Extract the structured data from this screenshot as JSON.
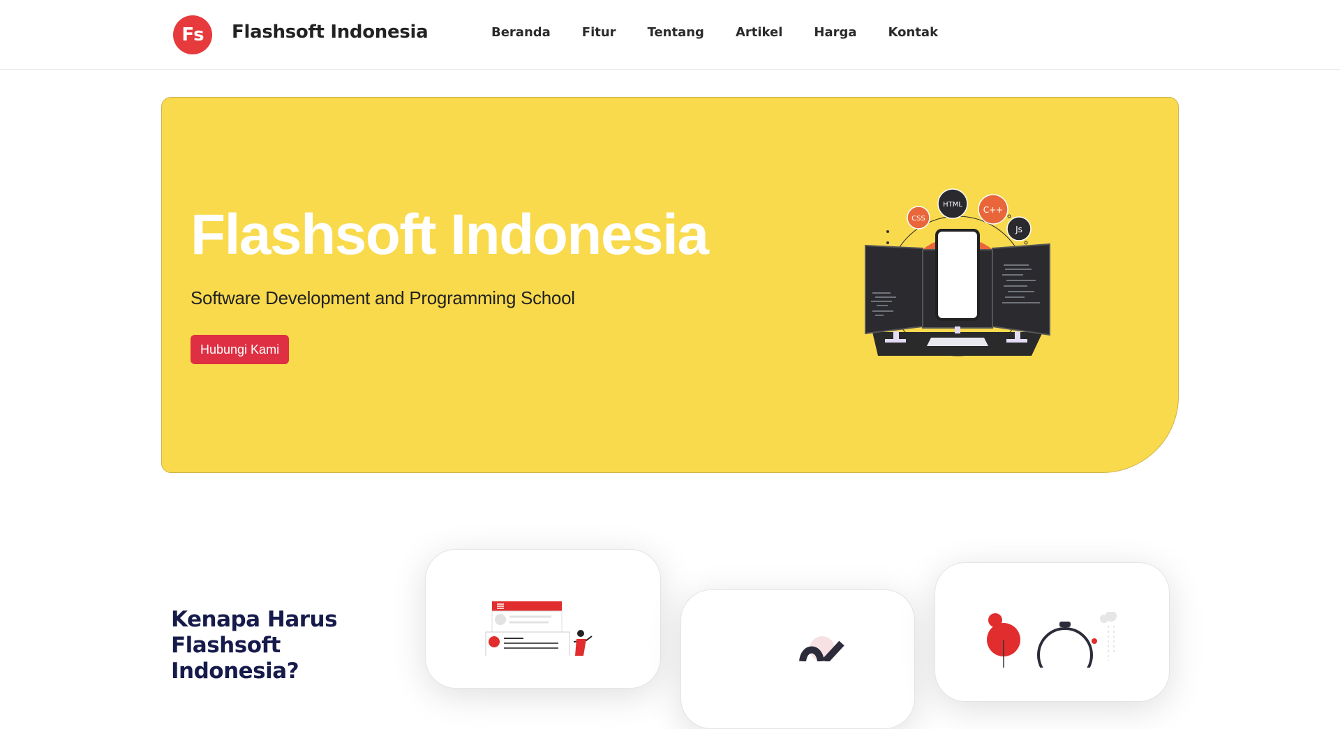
{
  "header": {
    "logo_text": "Fs",
    "brand": "Flashsoft Indonesia",
    "nav": [
      "Beranda",
      "Fitur",
      "Tentang",
      "Artikel",
      "Harga",
      "Kontak"
    ]
  },
  "hero": {
    "title": "Flashsoft Indonesia",
    "subtitle": "Software Development and Programming School",
    "cta_label": "Hubungi Kami",
    "illustration_labels": [
      "CSS",
      "HTML",
      "C++",
      "Js"
    ]
  },
  "why": {
    "title": "Kenapa Harus Flashsoft Indonesia?"
  },
  "colors": {
    "accent_red": "#e63a3d",
    "hero_yellow": "#f9da4d",
    "navy": "#161b4b"
  }
}
